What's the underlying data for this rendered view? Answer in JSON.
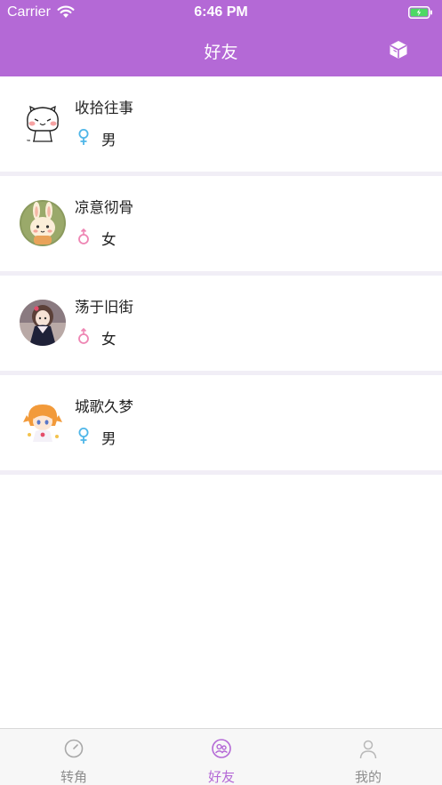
{
  "status_bar": {
    "carrier": "Carrier",
    "time": "6:46 PM"
  },
  "nav": {
    "title": "好友",
    "right_icon": "cube-icon"
  },
  "friends": [
    {
      "name": "收拾往事",
      "gender": "男",
      "gender_icon": "female-symbol-icon",
      "gender_color": "#4fb6e8"
    },
    {
      "name": "凉意彻骨",
      "gender": "女",
      "gender_icon": "male-symbol-icon",
      "gender_color": "#ee86b4"
    },
    {
      "name": "荡于旧街",
      "gender": "女",
      "gender_icon": "male-symbol-icon",
      "gender_color": "#ee86b4"
    },
    {
      "name": "城歌久梦",
      "gender": "男",
      "gender_icon": "female-symbol-icon",
      "gender_color": "#4fb6e8"
    }
  ],
  "tabs": [
    {
      "label": "转角",
      "icon": "clock-icon",
      "active": false
    },
    {
      "label": "好友",
      "icon": "friends-icon",
      "active": true
    },
    {
      "label": "我的",
      "icon": "person-icon",
      "active": false
    }
  ],
  "colors": {
    "accent": "#b469d6",
    "separator": "#f1eef6",
    "tab_inactive": "#8e8e8e"
  }
}
